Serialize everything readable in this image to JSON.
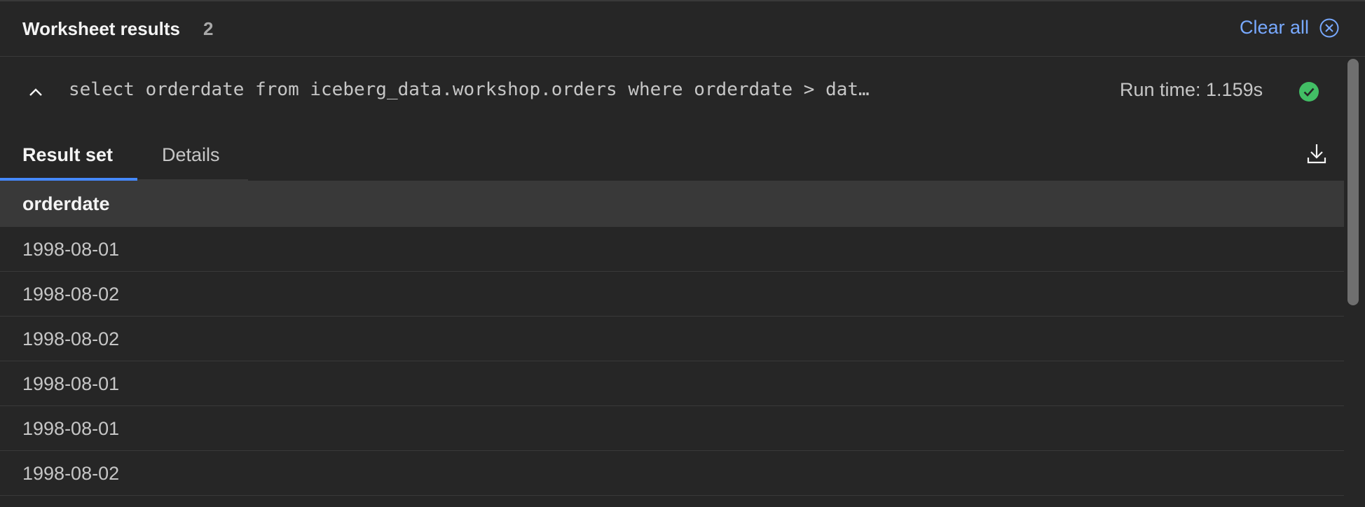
{
  "header": {
    "title": "Worksheet results",
    "count": "2",
    "clear_label": "Clear all"
  },
  "icons": {
    "clear": "close-circle-icon",
    "collapse": "chevron-up-icon",
    "status": "checkmark-filled-icon",
    "download": "download-icon"
  },
  "query": {
    "text": "select orderdate from iceberg_data.workshop.orders where orderdate > dat…",
    "runtime": "Run time: 1.159s"
  },
  "tabs": [
    {
      "label": "Result set",
      "active": true
    },
    {
      "label": "Details",
      "active": false
    }
  ],
  "table": {
    "columns": [
      "orderdate"
    ],
    "rows": [
      "1998-08-01",
      "1998-08-02",
      "1998-08-02",
      "1998-08-01",
      "1998-08-01",
      "1998-08-02"
    ]
  },
  "colors": {
    "accent": "#4589ff",
    "link": "#78a9ff",
    "success": "#42be65",
    "background": "#262626"
  }
}
